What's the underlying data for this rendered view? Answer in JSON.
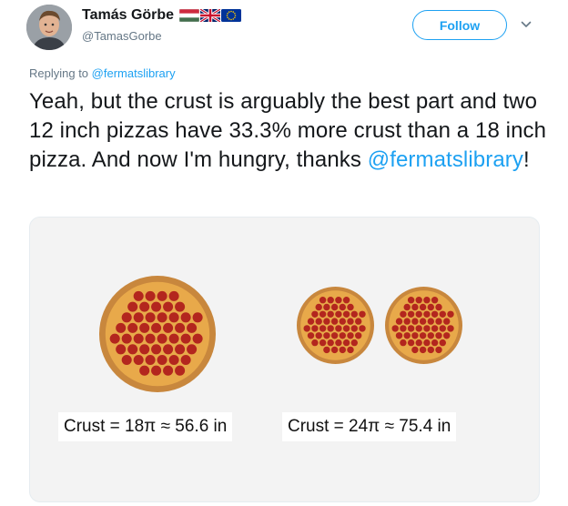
{
  "user": {
    "name": "Tamás Görbe",
    "handle": "@TamasGorbe",
    "flags": [
      "hungary-flag",
      "uk-flag",
      "eu-flag"
    ]
  },
  "follow_button": {
    "label": "Follow"
  },
  "reply": {
    "prefix": "Replying to",
    "mention": "@fermatslibrary"
  },
  "tweet": {
    "text_main": "Yeah, but the crust is arguably the best part and two 12 inch pizzas have 33.3% more crust than a 18 inch pizza. And now I'm hungry, thanks ",
    "mention": "@fermatslibrary",
    "text_end": "!"
  },
  "media": {
    "left_label": "Crust = 18π ≈ 56.6 in",
    "right_label": "Crust = 24π ≈ 75.4 in"
  },
  "colors": {
    "accent": "#1da1f2",
    "crust": "#c8873d",
    "cheese": "#e8a94a",
    "pepperoni": "#b3261e"
  }
}
